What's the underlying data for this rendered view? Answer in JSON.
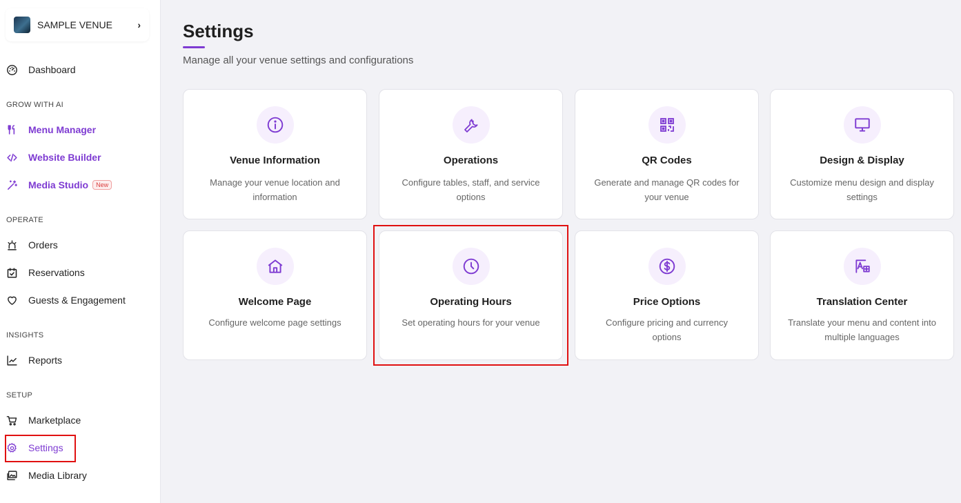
{
  "venue": {
    "name": "SAMPLE VENUE",
    "chevron": "›"
  },
  "sidebar": {
    "dashboard": "Dashboard",
    "sections": {
      "grow": "GROW WITH AI",
      "operate": "OPERATE",
      "insights": "INSIGHTS",
      "setup": "SETUP"
    },
    "items": {
      "menu_manager": "Menu Manager",
      "website_builder": "Website Builder",
      "media_studio": "Media Studio",
      "media_studio_badge": "New",
      "orders": "Orders",
      "reservations": "Reservations",
      "guests": "Guests & Engagement",
      "reports": "Reports",
      "marketplace": "Marketplace",
      "settings": "Settings",
      "media_library": "Media Library"
    }
  },
  "main": {
    "title": "Settings",
    "subtitle": "Manage all your venue settings and configurations",
    "cards": [
      {
        "title": "Venue Information",
        "desc": "Manage your venue location and information",
        "icon": "info-icon"
      },
      {
        "title": "Operations",
        "desc": "Configure tables, staff, and service options",
        "icon": "wrench-icon"
      },
      {
        "title": "QR Codes",
        "desc": "Generate and manage QR codes for your venue",
        "icon": "qr-code-icon"
      },
      {
        "title": "Design & Display",
        "desc": "Customize menu design and display settings",
        "icon": "monitor-icon"
      },
      {
        "title": "Welcome Page",
        "desc": "Configure welcome page settings",
        "icon": "home-icon"
      },
      {
        "title": "Operating Hours",
        "desc": "Set operating hours for your venue",
        "icon": "clock-icon"
      },
      {
        "title": "Price Options",
        "desc": "Configure pricing and currency options",
        "icon": "dollar-icon"
      },
      {
        "title": "Translation Center",
        "desc": "Translate your menu and content into multiple languages",
        "icon": "translate-icon"
      }
    ]
  },
  "colors": {
    "accent": "#7e3bd2",
    "highlight": "#e01010",
    "icon_bg": "#f6effd"
  }
}
